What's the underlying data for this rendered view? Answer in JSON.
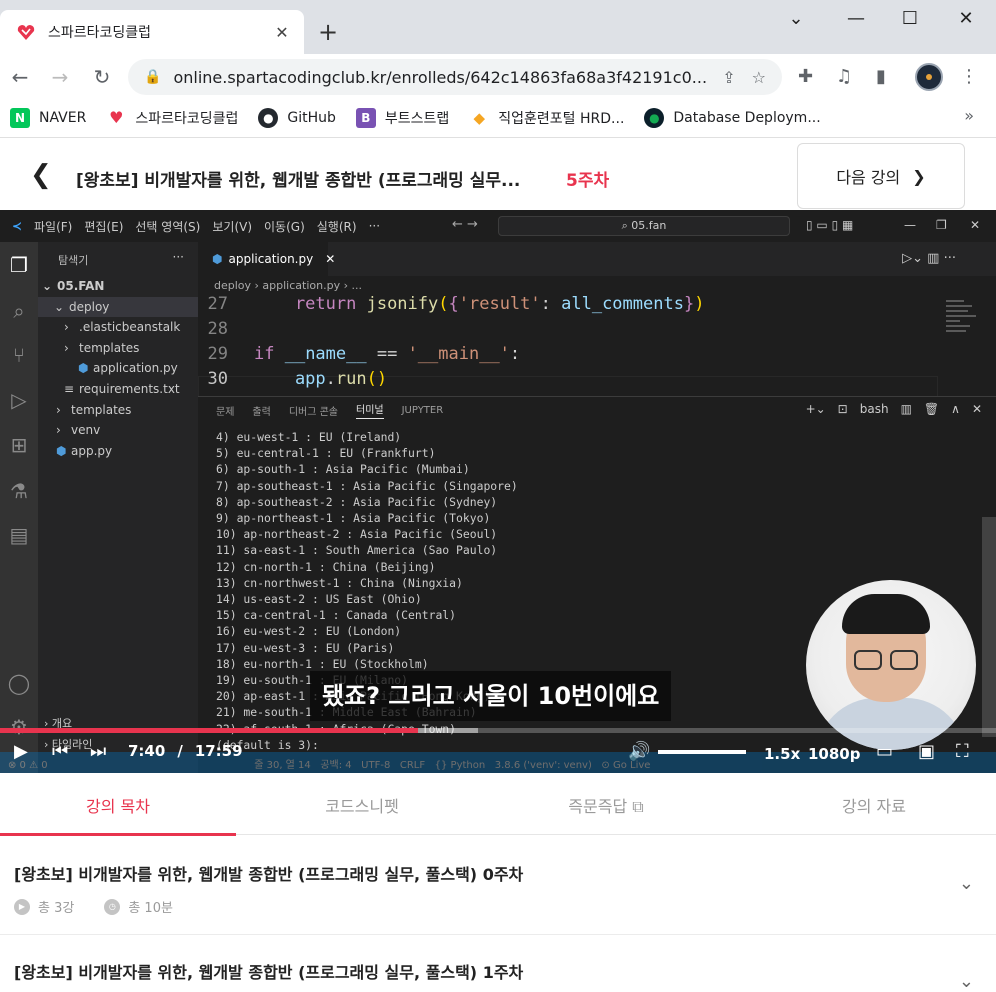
{
  "browser": {
    "tab_title": "스파르타코딩클럽",
    "tab_close": "✕",
    "new_tab": "+",
    "url": "online.spartacodingclub.kr/enrolleds/642c14863fa68a3f42191c0...",
    "bookmarks": [
      {
        "label": "NAVER",
        "icon": "N",
        "color": "#03c75a"
      },
      {
        "label": "스파르타코딩클럽",
        "icon": "♥",
        "color": "#e8344e"
      },
      {
        "label": "GitHub",
        "icon": "●",
        "color": "#24292f"
      },
      {
        "label": "부트스트랩",
        "icon": "B",
        "color": "#7952b3"
      },
      {
        "label": "직업훈련포털 HRD...",
        "icon": "◆",
        "color": "#f5a623"
      },
      {
        "label": "Database Deploym...",
        "icon": "●",
        "color": "#0b1f2a"
      }
    ],
    "bookmarks_more": "»"
  },
  "lecture": {
    "title": "[왕초보] 비개발자를 위한, 웹개발 종합반 (프로그래밍 실무...",
    "week": "5주차",
    "next_label": "다음 강의"
  },
  "vscode": {
    "menu": [
      "파일(F)",
      "편집(E)",
      "선택 영역(S)",
      "보기(V)",
      "이동(G)",
      "실행(R)",
      "···"
    ],
    "search": "05.fan",
    "explorer_title": "탐색기",
    "explorer_more": "···",
    "tree": [
      {
        "label": "05.FAN",
        "indent": 4,
        "prefix": "⌄",
        "bold": true
      },
      {
        "label": "deploy",
        "indent": 16,
        "prefix": "⌄",
        "selected": true
      },
      {
        "label": ".elasticbeanstalk",
        "indent": 26,
        "prefix": "›"
      },
      {
        "label": "templates",
        "indent": 26,
        "prefix": "›"
      },
      {
        "label": "application.py",
        "indent": 40,
        "prefix": "",
        "py": true
      },
      {
        "label": "requirements.txt",
        "indent": 26,
        "prefix": "≡"
      },
      {
        "label": "templates",
        "indent": 18,
        "prefix": "›"
      },
      {
        "label": "venv",
        "indent": 18,
        "prefix": "›"
      },
      {
        "label": "app.py",
        "indent": 18,
        "prefix": "",
        "py": true
      }
    ],
    "outline": "개요",
    "timeline": "타임라인",
    "tab": "application.py",
    "tab_close": "✕",
    "breadcrumbs": "deploy  ›  application.py  › ...",
    "code": [
      {
        "num": "27",
        "text": "    return jsonify({'result': all_comments})"
      },
      {
        "num": "28",
        "text": ""
      },
      {
        "num": "29",
        "text": "if __name__ == '__main__':"
      },
      {
        "num": "30",
        "text": "    app.run()"
      }
    ],
    "panel_tabs": [
      "문제",
      "출력",
      "디버그 콘솔",
      "터미널",
      "JUPYTER"
    ],
    "panel_shell": "bash",
    "terminal": [
      "4) eu-west-1 : EU (Ireland)",
      "5) eu-central-1 : EU (Frankfurt)",
      "6) ap-south-1 : Asia Pacific (Mumbai)",
      "7) ap-southeast-1 : Asia Pacific (Singapore)",
      "8) ap-southeast-2 : Asia Pacific (Sydney)",
      "9) ap-northeast-1 : Asia Pacific (Tokyo)",
      "10) ap-northeast-2 : Asia Pacific (Seoul)",
      "11) sa-east-1 : South America (Sao Paulo)",
      "12) cn-north-1 : China (Beijing)",
      "13) cn-northwest-1 : China (Ningxia)",
      "14) us-east-2 : US East (Ohio)",
      "15) ca-central-1 : Canada (Central)",
      "16) eu-west-2 : EU (London)",
      "17) eu-west-3 : EU (Paris)",
      "18) eu-north-1 : EU (Stockholm)",
      "19) eu-south-1 : EU (Milano)",
      "20) ap-east-1 : Asia Pacific (Hong Kong)",
      "21) me-south-1 : Middle East (Bahrain)",
      "22) af-south-1 : Africa (Cape Town)",
      "(default is 3): "
    ],
    "status": "⊗ 0 ⚠ 0                                                                 줄 30, 열 14   공백: 4   UTF-8   CRLF   {} Python   3.8.6 ('venv': venv)   ⊙ Go Live"
  },
  "video": {
    "subtitle": "됐죠? 그리고 서울이 10번이에요",
    "current_time": "7:40",
    "separator": "/",
    "duration": "17:59",
    "played_fraction": 0.42,
    "buffered_fraction": 0.48,
    "speed": "1.5x",
    "quality": "1080p"
  },
  "tabs": [
    "강의 목차",
    "코드스니펫",
    "즉문즉답",
    "강의 자료"
  ],
  "courses": [
    {
      "title": "[왕초보] 비개발자를 위한, 웹개발 종합반 (프로그래밍 실무, 풀스택) 0주차",
      "lessons": "총 3강",
      "duration": "총 10분"
    },
    {
      "title": "[왕초보] 비개발자를 위한, 웹개발 종합반 (프로그래밍 실무, 풀스택) 1주차"
    }
  ],
  "colors": {
    "brand": "#e8344e",
    "vscode_bg": "#1e1e1e"
  }
}
